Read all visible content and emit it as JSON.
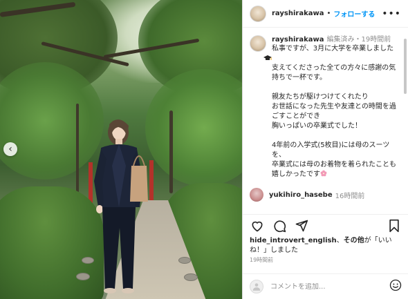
{
  "post": {
    "username": "rayshirakawa",
    "follow_label": "フォローする",
    "more_label": "•••",
    "separator": "•"
  },
  "caption": {
    "username": "rayshirakawa",
    "meta": "編集済み・19時間前",
    "text": "私事ですが、3月に大学を卒業しました\n\n支えてくださった全ての方々に感謝の気持ちで一杯です。\n\n親友たちが駆けつけてくれたり\nお世話になった先生や友達との時間を過ごすことができ\n胸いっぱいの卒業式でした！\n\n4年前の入学式(5枚目)には母のスーツを、\n卒業式には母のお着物を着られたことも\n嬉しかったです",
    "emojis": [
      "graduation-cap-emoji",
      "cherry-blossom-emoji"
    ]
  },
  "comment": {
    "username": "yukihiro_hasebe",
    "time": "16時間前"
  },
  "likes": {
    "user": "hide_introvert_english",
    "joiner": "、",
    "others": "その他",
    "suffix": "が「いいね！」しました"
  },
  "timestamp": "19時間前",
  "composer": {
    "placeholder": "コメントを追加..."
  },
  "nav": {
    "prev_label": "‹"
  },
  "icons": [
    "heart-icon",
    "comment-icon",
    "share-icon",
    "bookmark-icon",
    "emoji-icon"
  ],
  "colors": {
    "follow_blue": "#0095f6",
    "muted_gray": "#8e8e8e",
    "text": "#262626"
  }
}
